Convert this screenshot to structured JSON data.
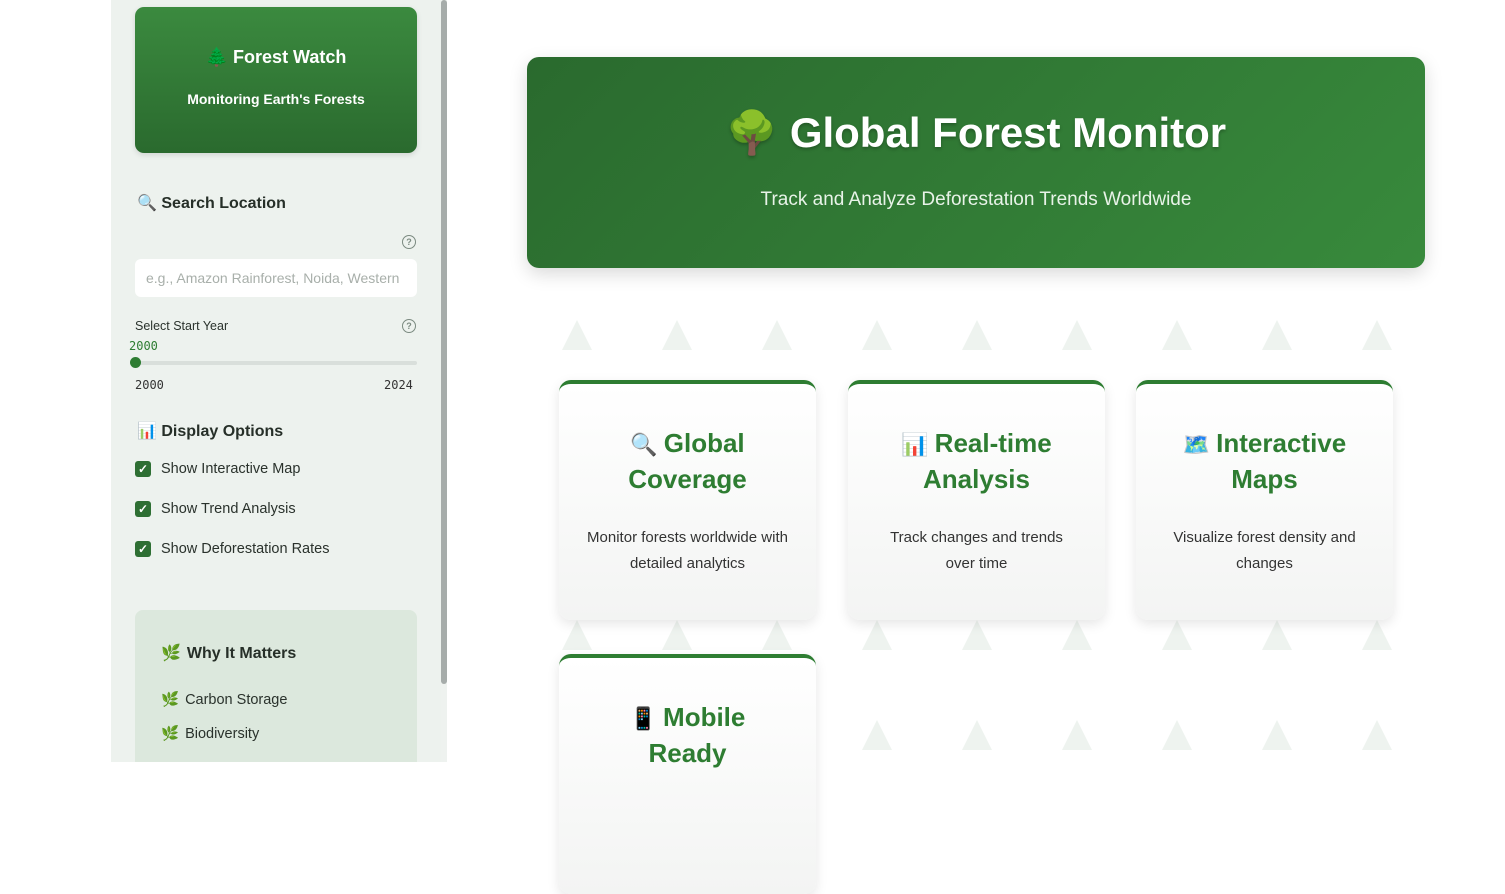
{
  "sidebar": {
    "brand_title": "Forest Watch",
    "brand_subtitle": "Monitoring Earth's Forests",
    "search_heading": "Search Location",
    "search_placeholder": "e.g., Amazon Rainforest, Noida, Western",
    "start_year_label": "Select Start Year",
    "start_year_value": "2000",
    "slider_min": "2000",
    "slider_max": "2024",
    "display_heading": "Display Options",
    "options": [
      {
        "label": "Show Interactive Map",
        "checked": true
      },
      {
        "label": "Show Trend Analysis",
        "checked": true
      },
      {
        "label": "Show Deforestation Rates",
        "checked": true
      }
    ],
    "why_heading": "Why It Matters",
    "why_items": [
      "Carbon Storage",
      "Biodiversity"
    ]
  },
  "hero": {
    "title": "Global Forest Monitor",
    "subtitle": "Track and Analyze Deforestation Trends Worldwide"
  },
  "features": [
    {
      "icon": "🔍",
      "title": "Global Coverage",
      "desc": "Monitor forests worldwide with detailed analytics"
    },
    {
      "icon": "📊",
      "title": "Real-time Analysis",
      "desc": "Track changes and trends over time"
    },
    {
      "icon": "🗺️",
      "title": "Interactive Maps",
      "desc": "Visualize forest density and changes"
    },
    {
      "icon": "📱",
      "title": "Mobile Ready",
      "desc": ""
    }
  ],
  "colors": {
    "accent": "#2e7d32",
    "hero_dark": "#2a6a2e",
    "sidebar_bg": "#edf2ee"
  }
}
